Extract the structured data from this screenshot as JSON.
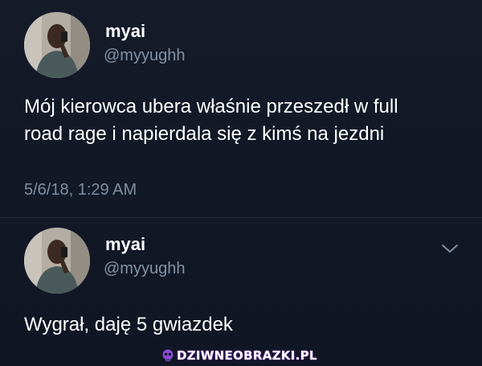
{
  "tweets": [
    {
      "name": "myai",
      "handle": "@myyughh",
      "text": "Mój kierowca ubera właśnie przeszedł w full\nroad rage i napierdala się z kimś na jezdni",
      "timestamp": "5/6/18, 1:29 AM"
    },
    {
      "name": "myai",
      "handle": "@myyughh",
      "text": "Wygrał, daję 5 gwiazdek"
    }
  ],
  "watermark": {
    "text": "DZIWNEOBRAZKI.PL",
    "icon": "skull-icon"
  },
  "colors": {
    "background": "#121724",
    "handle": "#8492a6",
    "timestamp": "#7f8ea4",
    "watermark_glow": "#7a3cc2"
  },
  "icons": {
    "menu": "chevron-down-icon"
  }
}
